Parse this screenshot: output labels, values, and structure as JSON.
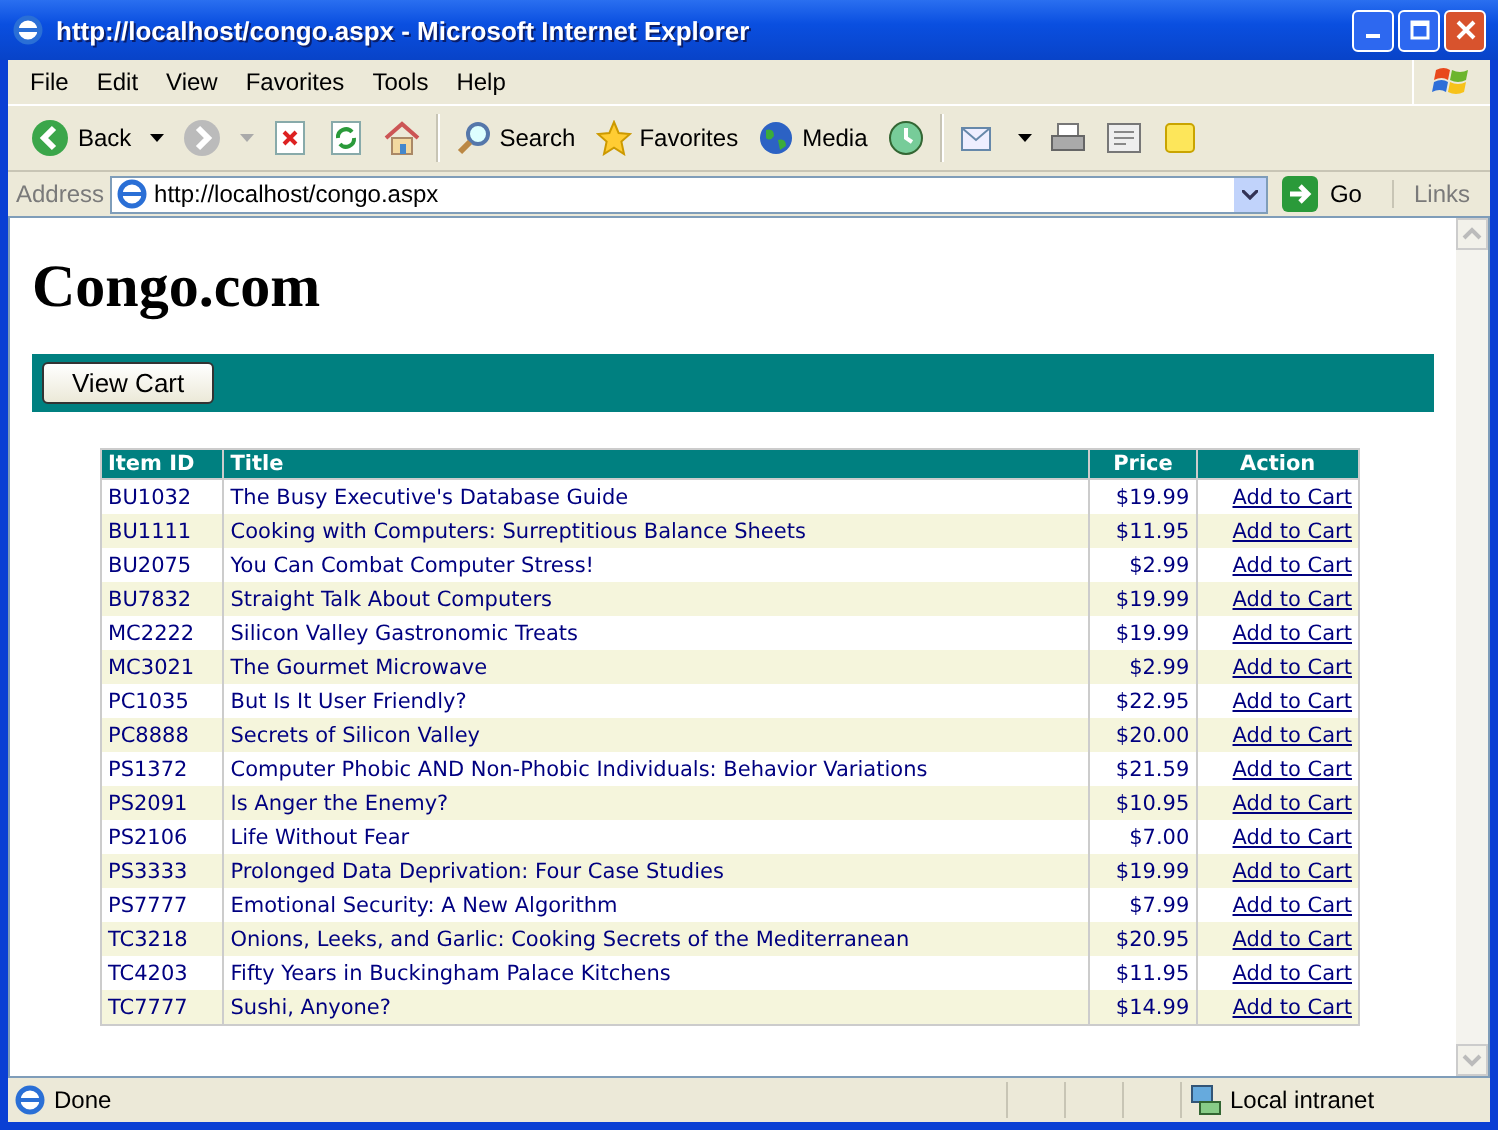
{
  "window": {
    "title": "http://localhost/congo.aspx - Microsoft Internet Explorer"
  },
  "menu": [
    "File",
    "Edit",
    "View",
    "Favorites",
    "Tools",
    "Help"
  ],
  "toolbar": {
    "back": "Back",
    "search": "Search",
    "favorites": "Favorites",
    "media": "Media"
  },
  "address_bar": {
    "label": "Address",
    "url": "http://localhost/congo.aspx",
    "go": "Go",
    "links": "Links"
  },
  "page": {
    "heading": "Congo.com",
    "view_cart": "View Cart",
    "table": {
      "columns": [
        "Item ID",
        "Title",
        "Price",
        "Action"
      ],
      "rows": [
        {
          "id": "BU1032",
          "title": "The Busy Executive's Database Guide",
          "price": "$19.99",
          "action": "Add to Cart"
        },
        {
          "id": "BU1111",
          "title": "Cooking with Computers: Surreptitious Balance Sheets",
          "price": "$11.95",
          "action": "Add to Cart"
        },
        {
          "id": "BU2075",
          "title": "You Can Combat Computer Stress!",
          "price": "$2.99",
          "action": "Add to Cart"
        },
        {
          "id": "BU7832",
          "title": "Straight Talk About Computers",
          "price": "$19.99",
          "action": "Add to Cart"
        },
        {
          "id": "MC2222",
          "title": "Silicon Valley Gastronomic Treats",
          "price": "$19.99",
          "action": "Add to Cart"
        },
        {
          "id": "MC3021",
          "title": "The Gourmet Microwave",
          "price": "$2.99",
          "action": "Add to Cart"
        },
        {
          "id": "PC1035",
          "title": "But Is It User Friendly?",
          "price": "$22.95",
          "action": "Add to Cart"
        },
        {
          "id": "PC8888",
          "title": "Secrets of Silicon Valley",
          "price": "$20.00",
          "action": "Add to Cart"
        },
        {
          "id": "PS1372",
          "title": "Computer Phobic AND Non-Phobic Individuals: Behavior Variations",
          "price": "$21.59",
          "action": "Add to Cart"
        },
        {
          "id": "PS2091",
          "title": "Is Anger the Enemy?",
          "price": "$10.95",
          "action": "Add to Cart"
        },
        {
          "id": "PS2106",
          "title": "Life Without Fear",
          "price": "$7.00",
          "action": "Add to Cart"
        },
        {
          "id": "PS3333",
          "title": "Prolonged Data Deprivation: Four Case Studies",
          "price": "$19.99",
          "action": "Add to Cart"
        },
        {
          "id": "PS7777",
          "title": "Emotional Security: A New Algorithm",
          "price": "$7.99",
          "action": "Add to Cart"
        },
        {
          "id": "TC3218",
          "title": "Onions, Leeks, and Garlic: Cooking Secrets of the Mediterranean",
          "price": "$20.95",
          "action": "Add to Cart"
        },
        {
          "id": "TC4203",
          "title": "Fifty Years in Buckingham Palace Kitchens",
          "price": "$11.95",
          "action": "Add to Cart"
        },
        {
          "id": "TC7777",
          "title": "Sushi, Anyone?",
          "price": "$14.99",
          "action": "Add to Cart"
        }
      ]
    }
  },
  "status_bar": {
    "text": "Done",
    "zone": "Local intranet"
  }
}
